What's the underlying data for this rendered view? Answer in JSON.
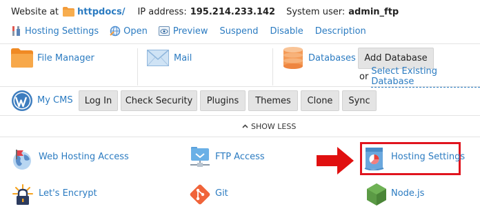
{
  "top_bar": {
    "website_at_label": "Website at",
    "domain_link": "httpdocs/",
    "ip_label": "IP address:",
    "ip_value": "195.214.233.142",
    "user_label": "System user:",
    "user_value": "admin_ftp"
  },
  "actions": {
    "hosting_settings": "Hosting Settings",
    "open": "Open",
    "preview": "Preview",
    "suspend": "Suspend",
    "disable": "Disable",
    "description": "Description"
  },
  "tools_row": {
    "file_manager": "File Manager",
    "mail": "Mail",
    "databases": "Databases",
    "add_database": "Add Database",
    "or_label": "or",
    "select_existing_database": "Select Existing Database"
  },
  "cms_row": {
    "label": "My CMS",
    "buttons": [
      "Log In",
      "Check Security",
      "Plugins",
      "Themes",
      "Clone",
      "Sync"
    ]
  },
  "show_less": "SHOW LESS",
  "services": {
    "web_hosting_access": "Web Hosting Access",
    "ftp_access": "FTP Access",
    "hosting_settings": "Hosting Settings",
    "lets_encrypt": "Let's Encrypt",
    "git": "Git",
    "nodejs": "Node.js"
  },
  "colors": {
    "link": "#2b7bc1",
    "highlight_box": "#e0141e",
    "arrow": "#e01010"
  }
}
